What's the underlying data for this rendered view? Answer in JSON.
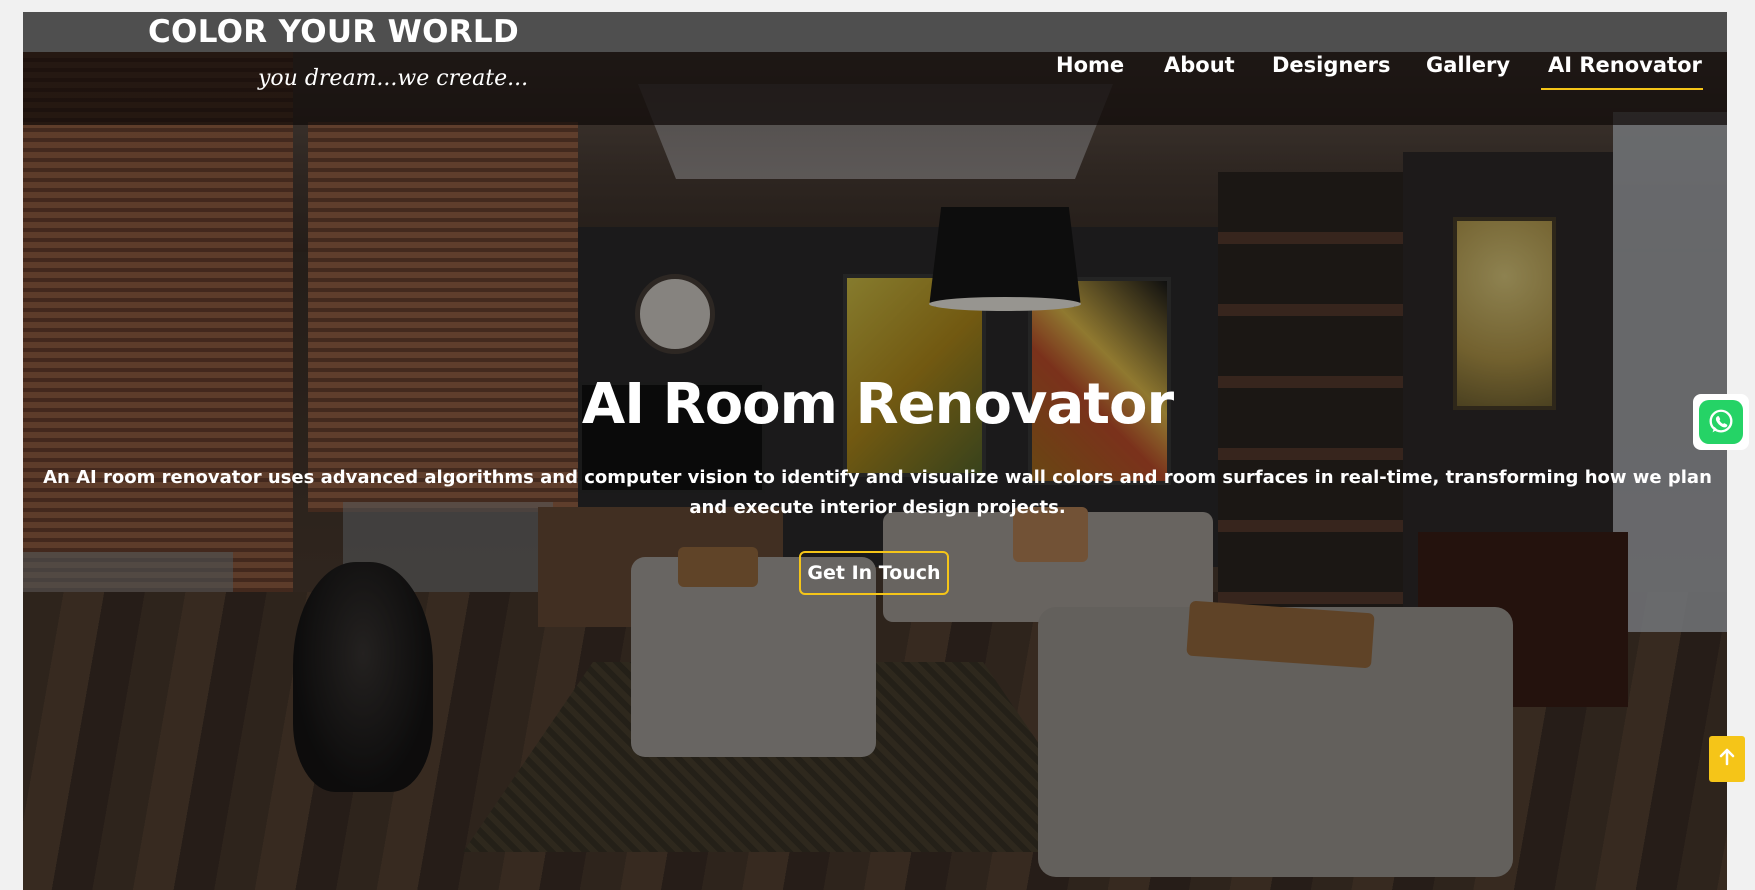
{
  "brand": {
    "title": "COLOR YOUR WORLD",
    "tagline": "you dream...we create..."
  },
  "nav": {
    "items": [
      {
        "label": "Home",
        "active": false
      },
      {
        "label": "About",
        "active": false
      },
      {
        "label": "Designers",
        "active": false
      },
      {
        "label": "Gallery",
        "active": false
      },
      {
        "label": "AI Renovator",
        "active": true
      }
    ]
  },
  "hero": {
    "title": "AI Room Renovator",
    "description": "An AI room renovator uses advanced algorithms and computer vision to identify and visualize wall colors and room surfaces in real-time, transforming how we plan and execute interior design projects.",
    "cta_label": "Get In Touch"
  },
  "floating": {
    "whatsapp_icon": "whatsapp-icon",
    "scroll_top_icon": "arrow-up-icon"
  },
  "colors": {
    "accent": "#f5c518",
    "whatsapp": "#25d366",
    "text": "#ffffff"
  }
}
